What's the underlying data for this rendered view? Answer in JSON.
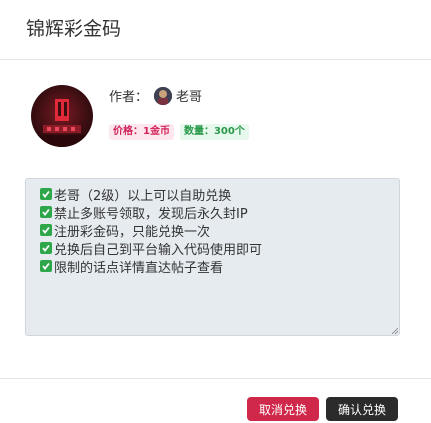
{
  "modal": {
    "title": "锦辉彩金码"
  },
  "author": {
    "label": "作者：",
    "name": "老哥"
  },
  "meta": {
    "price": "价格：1金币",
    "quantity": "数量：300个"
  },
  "description": {
    "lines": [
      "老哥（2级）以上可以自助兑换",
      "禁止多账号领取，发现后永久封IP",
      "注册彩金码，只能兑换一次",
      "兑换后自己到平台输入代码使用即可",
      "限制的话点详情直达帖子查看"
    ]
  },
  "buttons": {
    "cancel": "取消兑换",
    "confirm": "确认兑换"
  },
  "colors": {
    "cancel": "#d0284a",
    "confirm": "#2b2b2b",
    "check": "#2ea64a",
    "price": "#d1245a",
    "quantity": "#2a9a4a"
  }
}
